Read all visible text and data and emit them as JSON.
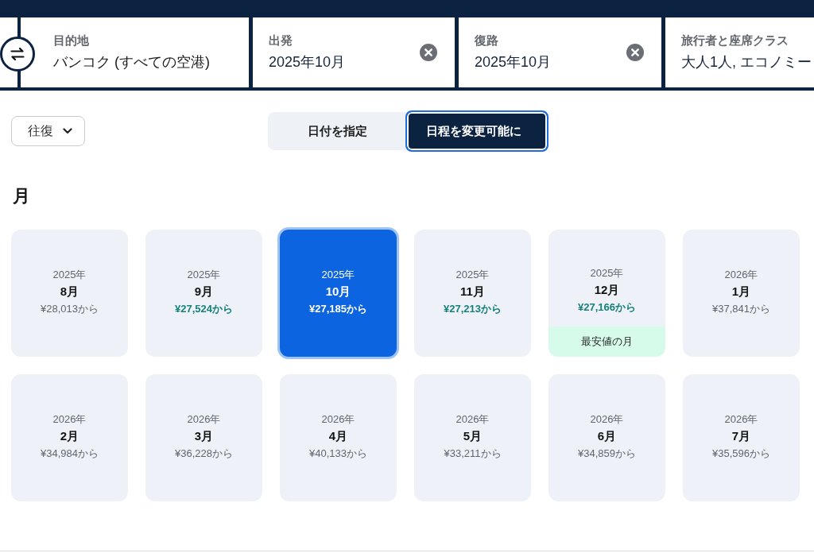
{
  "search_bar": {
    "fields": [
      {
        "label": "目的地",
        "value": "バンコク (すべての空港)",
        "clearable": false
      },
      {
        "label": "出発",
        "value": "2025年10月",
        "clearable": true
      },
      {
        "label": "復路",
        "value": "2025年10月",
        "clearable": true
      },
      {
        "label": "旅行者と座席クラス",
        "value": "大人1人, エコノミー",
        "clearable": false
      }
    ]
  },
  "trip_type": {
    "value": "往復"
  },
  "date_mode": {
    "options": [
      {
        "label": "日付を指定",
        "selected": false
      },
      {
        "label": "日程を変更可能に",
        "selected": true
      }
    ]
  },
  "months_section": {
    "title": "月",
    "months": [
      {
        "year": "2025年",
        "month": "8月",
        "price": "¥28,013から",
        "cheap": false,
        "selected": false
      },
      {
        "year": "2025年",
        "month": "9月",
        "price": "¥27,524から",
        "cheap": true,
        "selected": false
      },
      {
        "year": "2025年",
        "month": "10月",
        "price": "¥27,185から",
        "cheap": true,
        "selected": true
      },
      {
        "year": "2025年",
        "month": "11月",
        "price": "¥27,213から",
        "cheap": true,
        "selected": false
      },
      {
        "year": "2025年",
        "month": "12月",
        "price": "¥27,166から",
        "cheap": true,
        "selected": false,
        "badge": "最安値の月"
      },
      {
        "year": "2026年",
        "month": "1月",
        "price": "¥37,841から",
        "cheap": false,
        "selected": false
      },
      {
        "year": "2026年",
        "month": "2月",
        "price": "¥34,984から",
        "cheap": false,
        "selected": false
      },
      {
        "year": "2026年",
        "month": "3月",
        "price": "¥36,228から",
        "cheap": false,
        "selected": false
      },
      {
        "year": "2026年",
        "month": "4月",
        "price": "¥40,133から",
        "cheap": false,
        "selected": false
      },
      {
        "year": "2026年",
        "month": "5月",
        "price": "¥33,211から",
        "cheap": false,
        "selected": false
      },
      {
        "year": "2026年",
        "month": "6月",
        "price": "¥34,859から",
        "cheap": false,
        "selected": false
      },
      {
        "year": "2026年",
        "month": "7月",
        "price": "¥35,596から",
        "cheap": false,
        "selected": false
      }
    ]
  }
}
